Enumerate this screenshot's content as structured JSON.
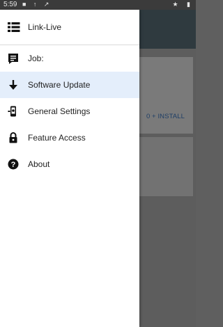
{
  "status_bar": {
    "time": "5:59",
    "left_icons": "■ ↑ ↗",
    "right_icons": "★ ▮"
  },
  "background": {
    "install_label": "0 + INSTALL"
  },
  "drawer": {
    "header": {
      "label": "Link-Live",
      "icon": "list-icon"
    },
    "items": [
      {
        "label": "Job:",
        "icon": "clipboard-icon",
        "selected": false
      },
      {
        "label": "Software Update",
        "icon": "arrow-down-icon",
        "selected": true
      },
      {
        "label": "General Settings",
        "icon": "device-settings-icon",
        "selected": false
      },
      {
        "label": "Feature Access",
        "icon": "lock-icon",
        "selected": false
      },
      {
        "label": "About",
        "icon": "help-circle-icon",
        "selected": false
      }
    ]
  },
  "colors": {
    "selected_background": "#e4eefb",
    "appbar": "#2f3a3f",
    "scrim": "#5d5d5d"
  }
}
